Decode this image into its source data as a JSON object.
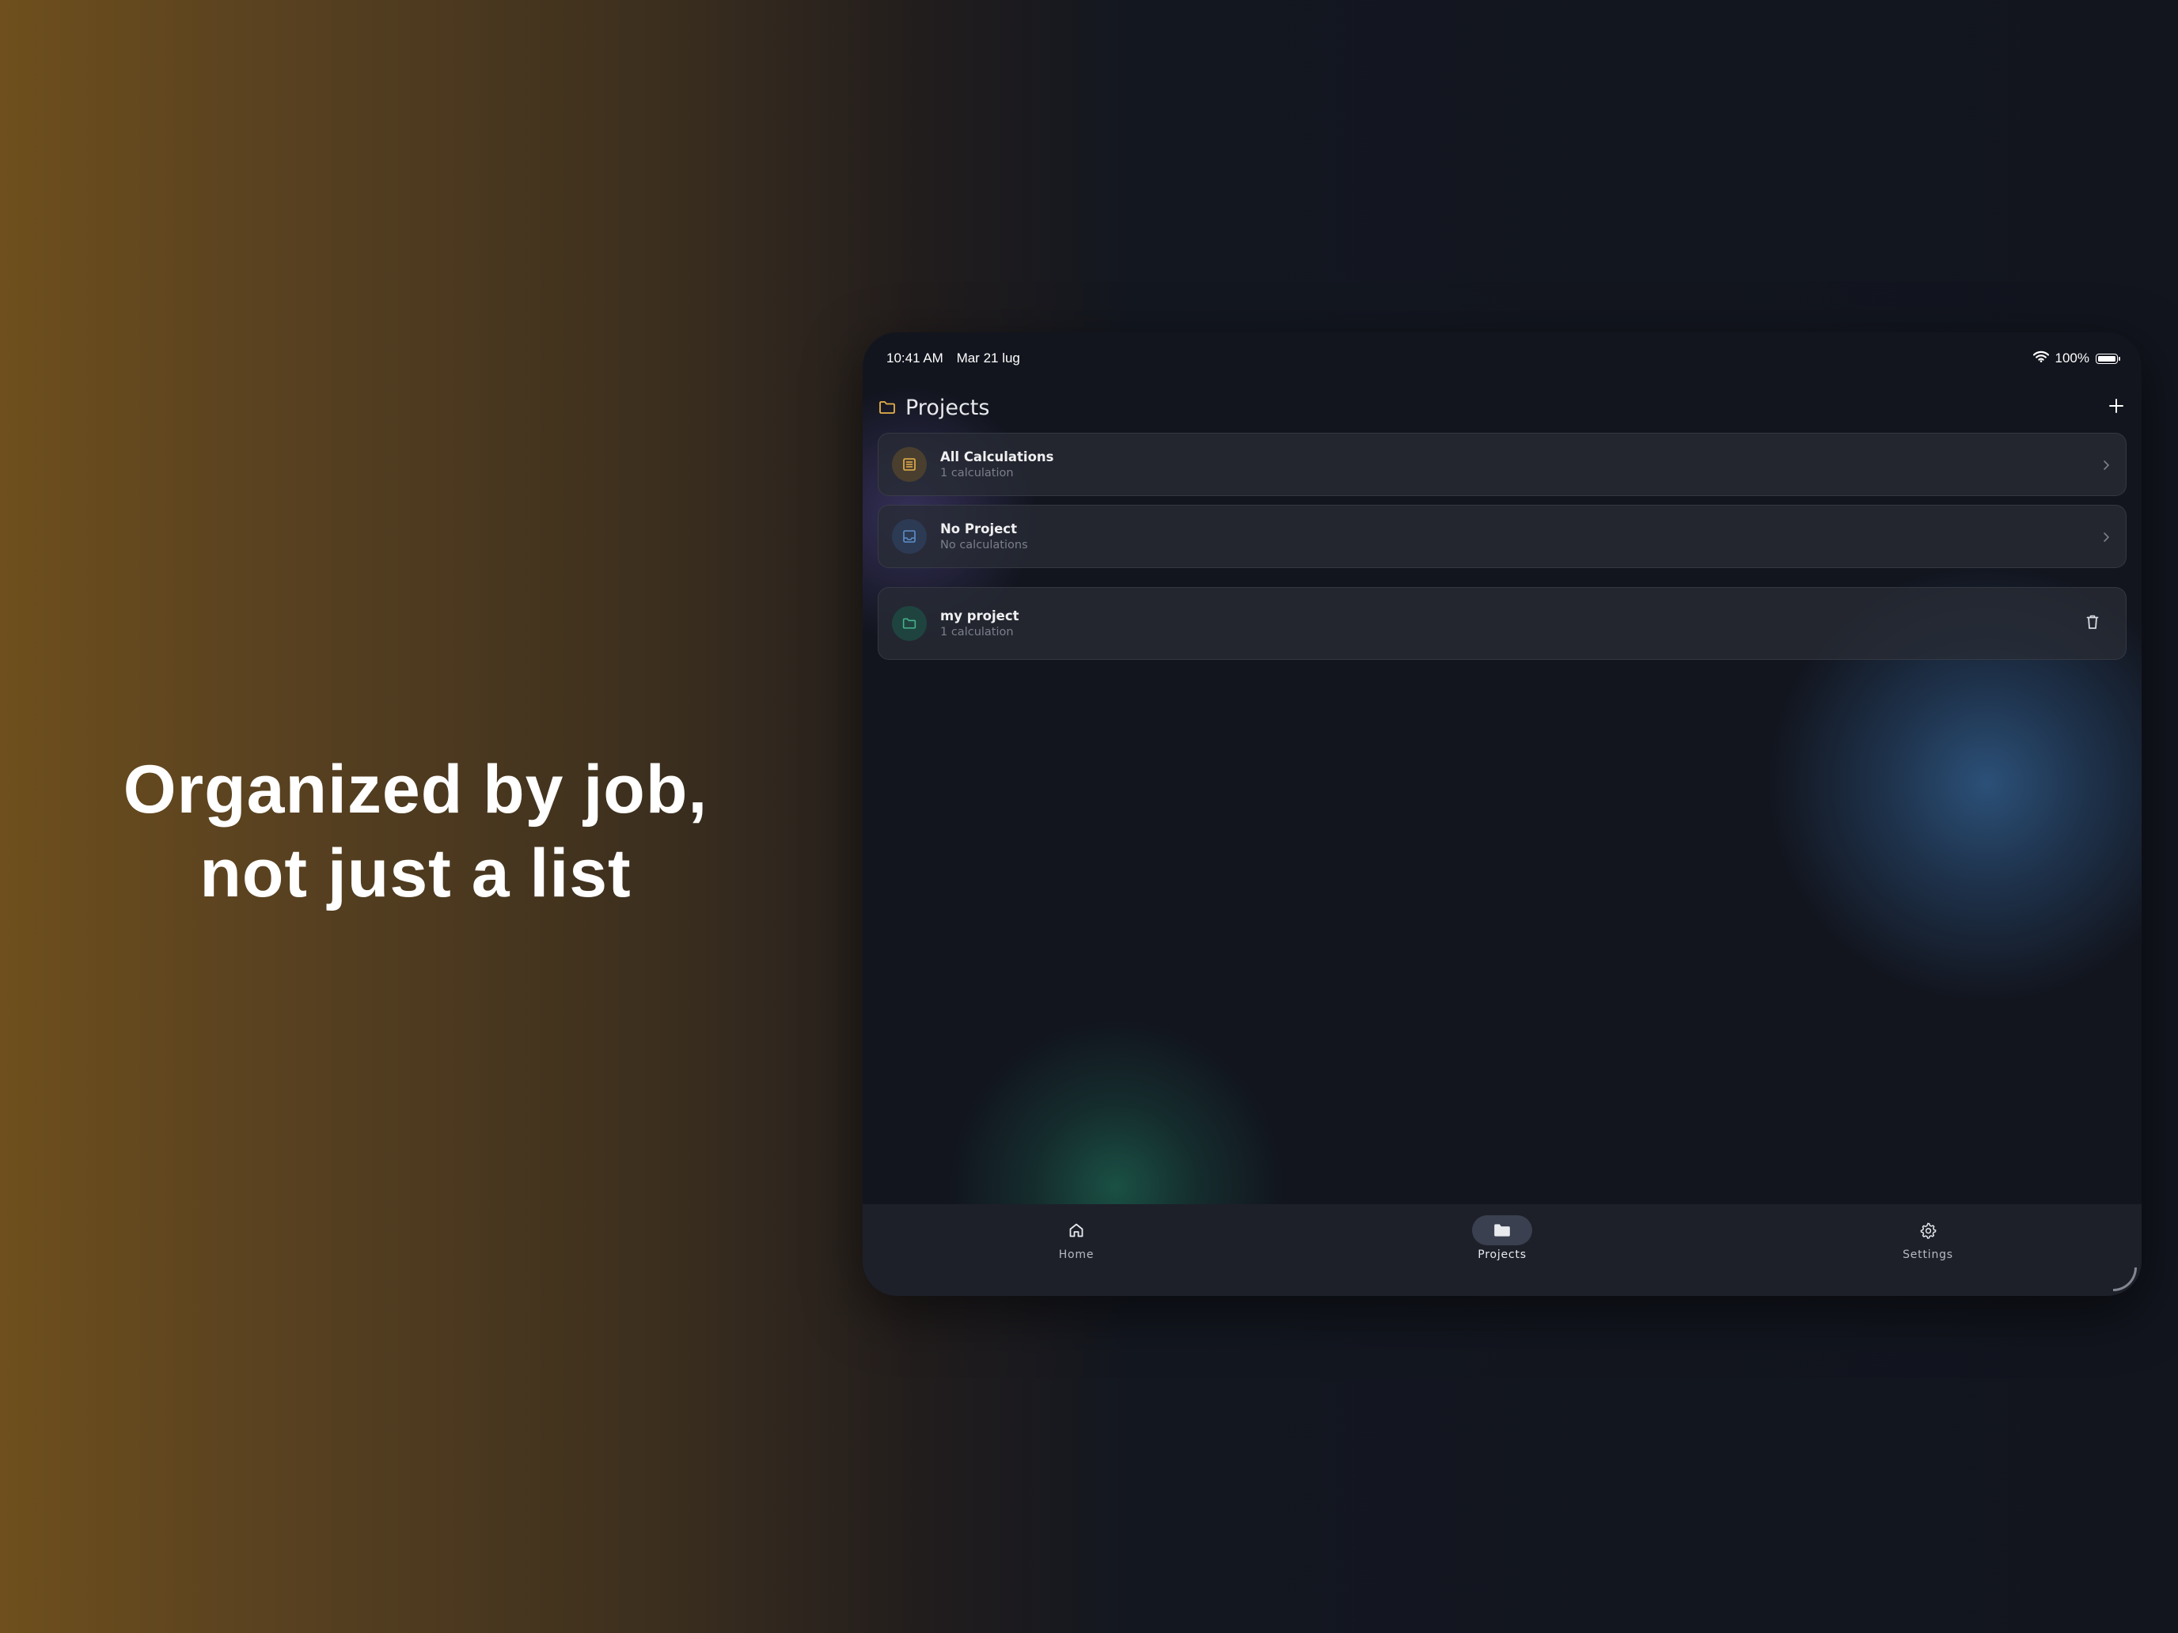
{
  "headline": {
    "line1": "Organized by job,",
    "line2": "not just a list"
  },
  "status_bar": {
    "time": "10:41 AM",
    "date": "Mar 21 lug",
    "battery": "100%"
  },
  "header": {
    "title": "Projects",
    "folder_icon": "folder-icon",
    "add_icon": "plus-icon"
  },
  "items": [
    {
      "title": "All Calculations",
      "subtitle": "1 calculation",
      "icon": "list-icon",
      "action": "chevron-right-icon"
    },
    {
      "title": "No Project",
      "subtitle": "No calculations",
      "icon": "inbox-icon",
      "action": "chevron-right-icon"
    },
    {
      "title": "my project",
      "subtitle": "1 calculation",
      "icon": "folder-icon",
      "action": "trash-icon"
    }
  ],
  "tabs": [
    {
      "label": "Home",
      "icon": "home-icon",
      "active": false
    },
    {
      "label": "Projects",
      "icon": "folder-icon",
      "active": true
    },
    {
      "label": "Settings",
      "icon": "gear-icon",
      "active": false
    }
  ],
  "colors": {
    "accent_gold": "#e8b14a",
    "accent_blue": "#5f8fc8",
    "accent_green": "#46b48a",
    "device_background": "#12151e",
    "card_background": "#282b35",
    "tabbar_background": "#1d2029"
  }
}
